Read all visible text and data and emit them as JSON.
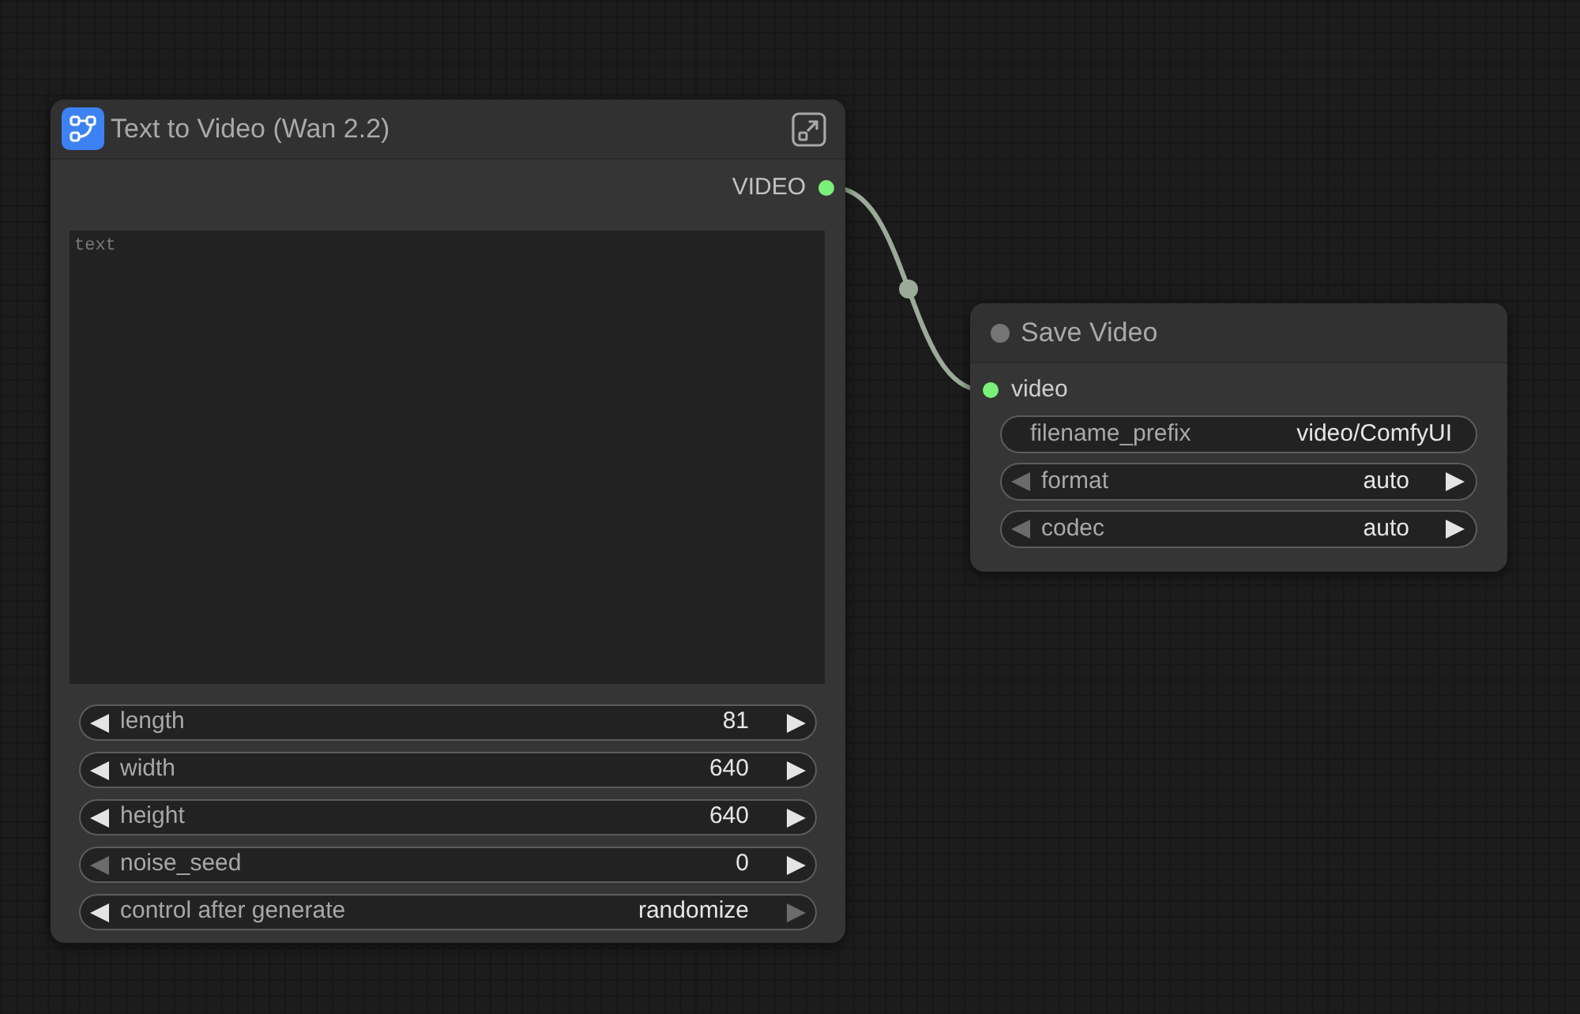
{
  "nodes": [
    {
      "kind": "subgraph",
      "title": "Text to Video (Wan 2.2)",
      "outputs": [
        {
          "label": "VIDEO",
          "connected": true
        }
      ],
      "textarea": {
        "placeholder": "text"
      },
      "widgets": [
        {
          "kind": "stepper",
          "label": "length",
          "value": "81",
          "left_disabled": false,
          "right_disabled": false
        },
        {
          "kind": "stepper",
          "label": "width",
          "value": "640",
          "left_disabled": false,
          "right_disabled": false
        },
        {
          "kind": "stepper",
          "label": "height",
          "value": "640",
          "left_disabled": false,
          "right_disabled": false
        },
        {
          "kind": "stepper",
          "label": "noise_seed",
          "value": "0",
          "left_disabled": true,
          "right_disabled": false
        },
        {
          "kind": "stepper",
          "label": "control after generate",
          "value": "randomize",
          "left_disabled": false,
          "right_disabled": true
        }
      ]
    },
    {
      "kind": "plain",
      "title": "Save Video",
      "inputs": [
        {
          "label": "video",
          "connected": true
        }
      ],
      "widgets": [
        {
          "kind": "text",
          "label": "filename_prefix",
          "value": "video/ComfyUI"
        },
        {
          "kind": "stepper",
          "label": "format",
          "value": "auto",
          "left_disabled": true,
          "right_disabled": false
        },
        {
          "kind": "stepper",
          "label": "codec",
          "value": "auto",
          "left_disabled": true,
          "right_disabled": false
        }
      ]
    }
  ]
}
